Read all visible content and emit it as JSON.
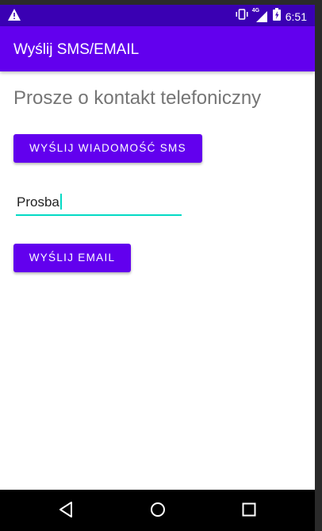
{
  "status_bar": {
    "time": "6:51",
    "network_label": "4G",
    "icons": [
      "warning-icon",
      "vibrate-icon",
      "signal-icon",
      "battery-icon"
    ]
  },
  "app_bar": {
    "title": "Wyślij SMS/EMAIL"
  },
  "main": {
    "heading": "Prosze o kontakt telefoniczny",
    "sms_button_label": "WYŚLIJ WIADOMOŚĆ SMS",
    "message_field_value": "Prosba",
    "email_button_label": "WYŚLIJ EMAIL"
  },
  "nav_bar": {
    "icons": [
      "back-icon",
      "home-icon",
      "recents-icon"
    ]
  },
  "colors": {
    "primary": "#6200ee",
    "primary_dark": "#3a00b3",
    "accent": "#03dac5"
  }
}
